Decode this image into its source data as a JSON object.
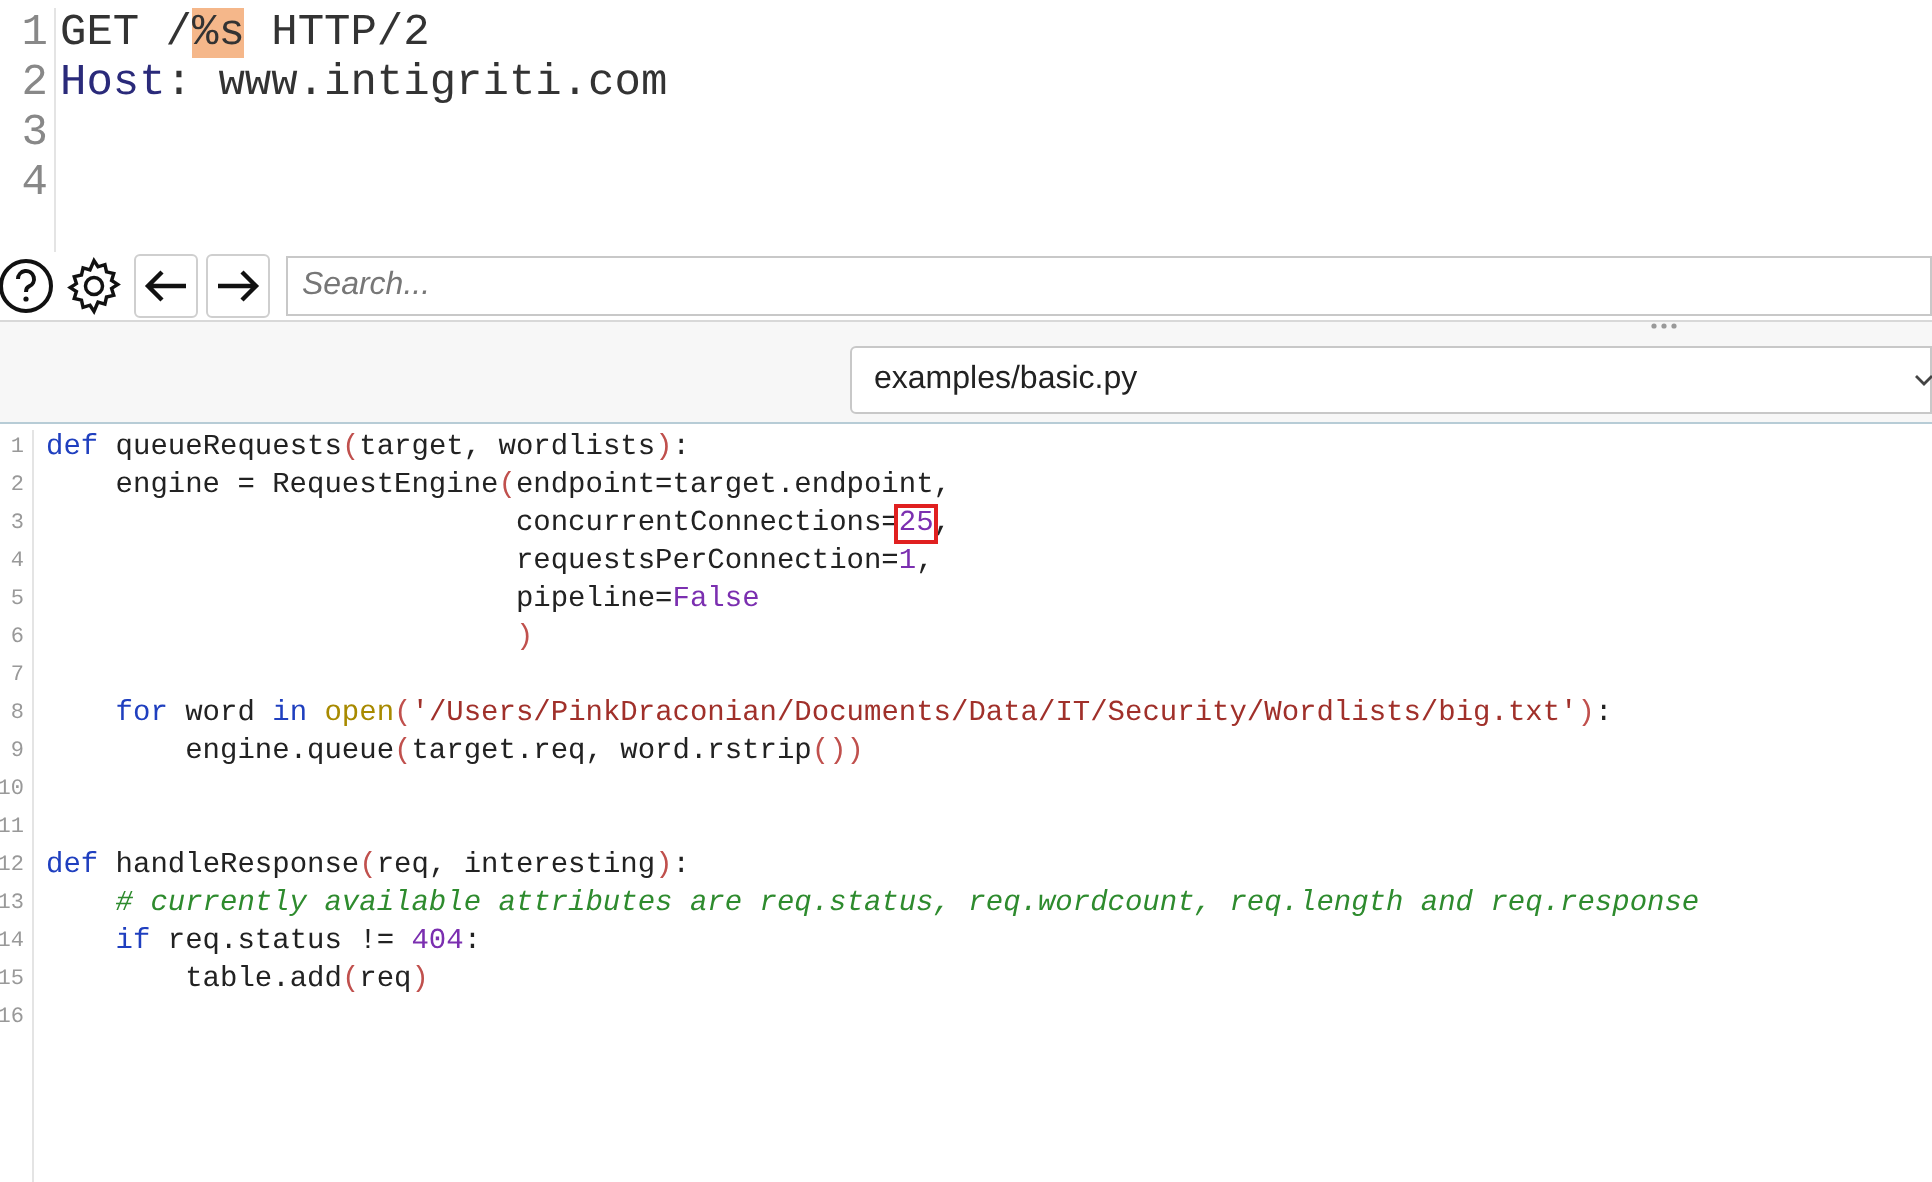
{
  "request_editor": {
    "lines": [
      {
        "number": "1",
        "tokens": [
          {
            "kind": "plain",
            "text": "GET /"
          },
          {
            "kind": "marker",
            "text": "%s"
          },
          {
            "kind": "plain",
            "text": " HTTP/2"
          }
        ]
      },
      {
        "number": "2",
        "tokens": [
          {
            "kind": "header",
            "text": "Host"
          },
          {
            "kind": "plain",
            "text": ": www.intigriti.com"
          }
        ]
      },
      {
        "number": "3"
      },
      {
        "number": "4"
      }
    ]
  },
  "toolbar": {
    "search": {
      "placeholder": "Search..."
    }
  },
  "script_select": {
    "value": "examples/basic.py"
  },
  "code_editor": {
    "lines": [
      {
        "number": "1",
        "kind": "top",
        "tokens": [
          {
            "kind": "keyword",
            "text": "def"
          },
          {
            "kind": "plain",
            "text": " queueRequests"
          },
          {
            "kind": "paren",
            "text": "("
          },
          {
            "kind": "plain",
            "text": "target, wordlists"
          },
          {
            "kind": "paren",
            "text": ")"
          },
          {
            "kind": "plain",
            "text": ":"
          }
        ]
      },
      {
        "number": "2",
        "kind": "block",
        "tokens": [
          {
            "kind": "plain",
            "text": "engine = RequestEngine"
          },
          {
            "kind": "paren",
            "text": "("
          },
          {
            "kind": "plain",
            "text": "endpoint=target.endpoint,"
          }
        ]
      },
      {
        "number": "3",
        "kind": "continuation",
        "tokens": [
          {
            "kind": "plain",
            "text": "concurrentConnections="
          },
          {
            "kind": "number",
            "text": "25",
            "boxed": true
          },
          {
            "kind": "plain",
            "text": ","
          }
        ]
      },
      {
        "number": "4",
        "kind": "continuation",
        "tokens": [
          {
            "kind": "plain",
            "text": "requestsPerConnection="
          },
          {
            "kind": "number",
            "text": "1"
          },
          {
            "kind": "plain",
            "text": ","
          }
        ]
      },
      {
        "number": "5",
        "kind": "continuation",
        "tokens": [
          {
            "kind": "plain",
            "text": "pipeline="
          },
          {
            "kind": "constant",
            "text": "False"
          }
        ]
      },
      {
        "number": "6",
        "kind": "continuation",
        "tokens": [
          {
            "kind": "paren",
            "text": ")"
          }
        ]
      },
      {
        "number": "7"
      },
      {
        "number": "8",
        "kind": "block",
        "tokens": [
          {
            "kind": "keyword",
            "text": "for"
          },
          {
            "kind": "plain",
            "text": " word "
          },
          {
            "kind": "keyword",
            "text": "in"
          },
          {
            "kind": "builtin",
            "text": " open"
          },
          {
            "kind": "paren",
            "text": "("
          },
          {
            "kind": "string",
            "text": "'/Users/PinkDraconian/Documents/Data/IT/Security/Wordlists/big.txt'"
          },
          {
            "kind": "paren",
            "text": ")"
          },
          {
            "kind": "plain",
            "text": ":"
          }
        ]
      },
      {
        "number": "9",
        "kind": "nested",
        "tokens": [
          {
            "kind": "plain",
            "text": "engine.queue"
          },
          {
            "kind": "paren",
            "text": "("
          },
          {
            "kind": "plain",
            "text": "target.req, word.rstrip"
          },
          {
            "kind": "paren",
            "text": "())"
          }
        ]
      },
      {
        "number": "10"
      },
      {
        "number": "11"
      },
      {
        "number": "12",
        "kind": "top",
        "tokens": [
          {
            "kind": "keyword",
            "text": "def"
          },
          {
            "kind": "plain",
            "text": " handleResponse"
          },
          {
            "kind": "paren",
            "text": "("
          },
          {
            "kind": "plain",
            "text": "req, interesting"
          },
          {
            "kind": "paren",
            "text": ")"
          },
          {
            "kind": "plain",
            "text": ":"
          }
        ]
      },
      {
        "number": "13",
        "kind": "block",
        "tokens": [
          {
            "kind": "comment",
            "text": "# currently available attributes are req.status, req.wordcount, req.length and req.response"
          }
        ]
      },
      {
        "number": "14",
        "kind": "block",
        "tokens": [
          {
            "kind": "keyword",
            "text": "if"
          },
          {
            "kind": "plain",
            "text": " req.status != "
          },
          {
            "kind": "number",
            "text": "404"
          },
          {
            "kind": "plain",
            "text": ":"
          }
        ]
      },
      {
        "number": "15",
        "kind": "nested",
        "tokens": [
          {
            "kind": "plain",
            "text": "table.add"
          },
          {
            "kind": "paren",
            "text": "("
          },
          {
            "kind": "plain",
            "text": "req"
          },
          {
            "kind": "paren",
            "text": ")"
          }
        ]
      },
      {
        "number": "16"
      }
    ]
  }
}
